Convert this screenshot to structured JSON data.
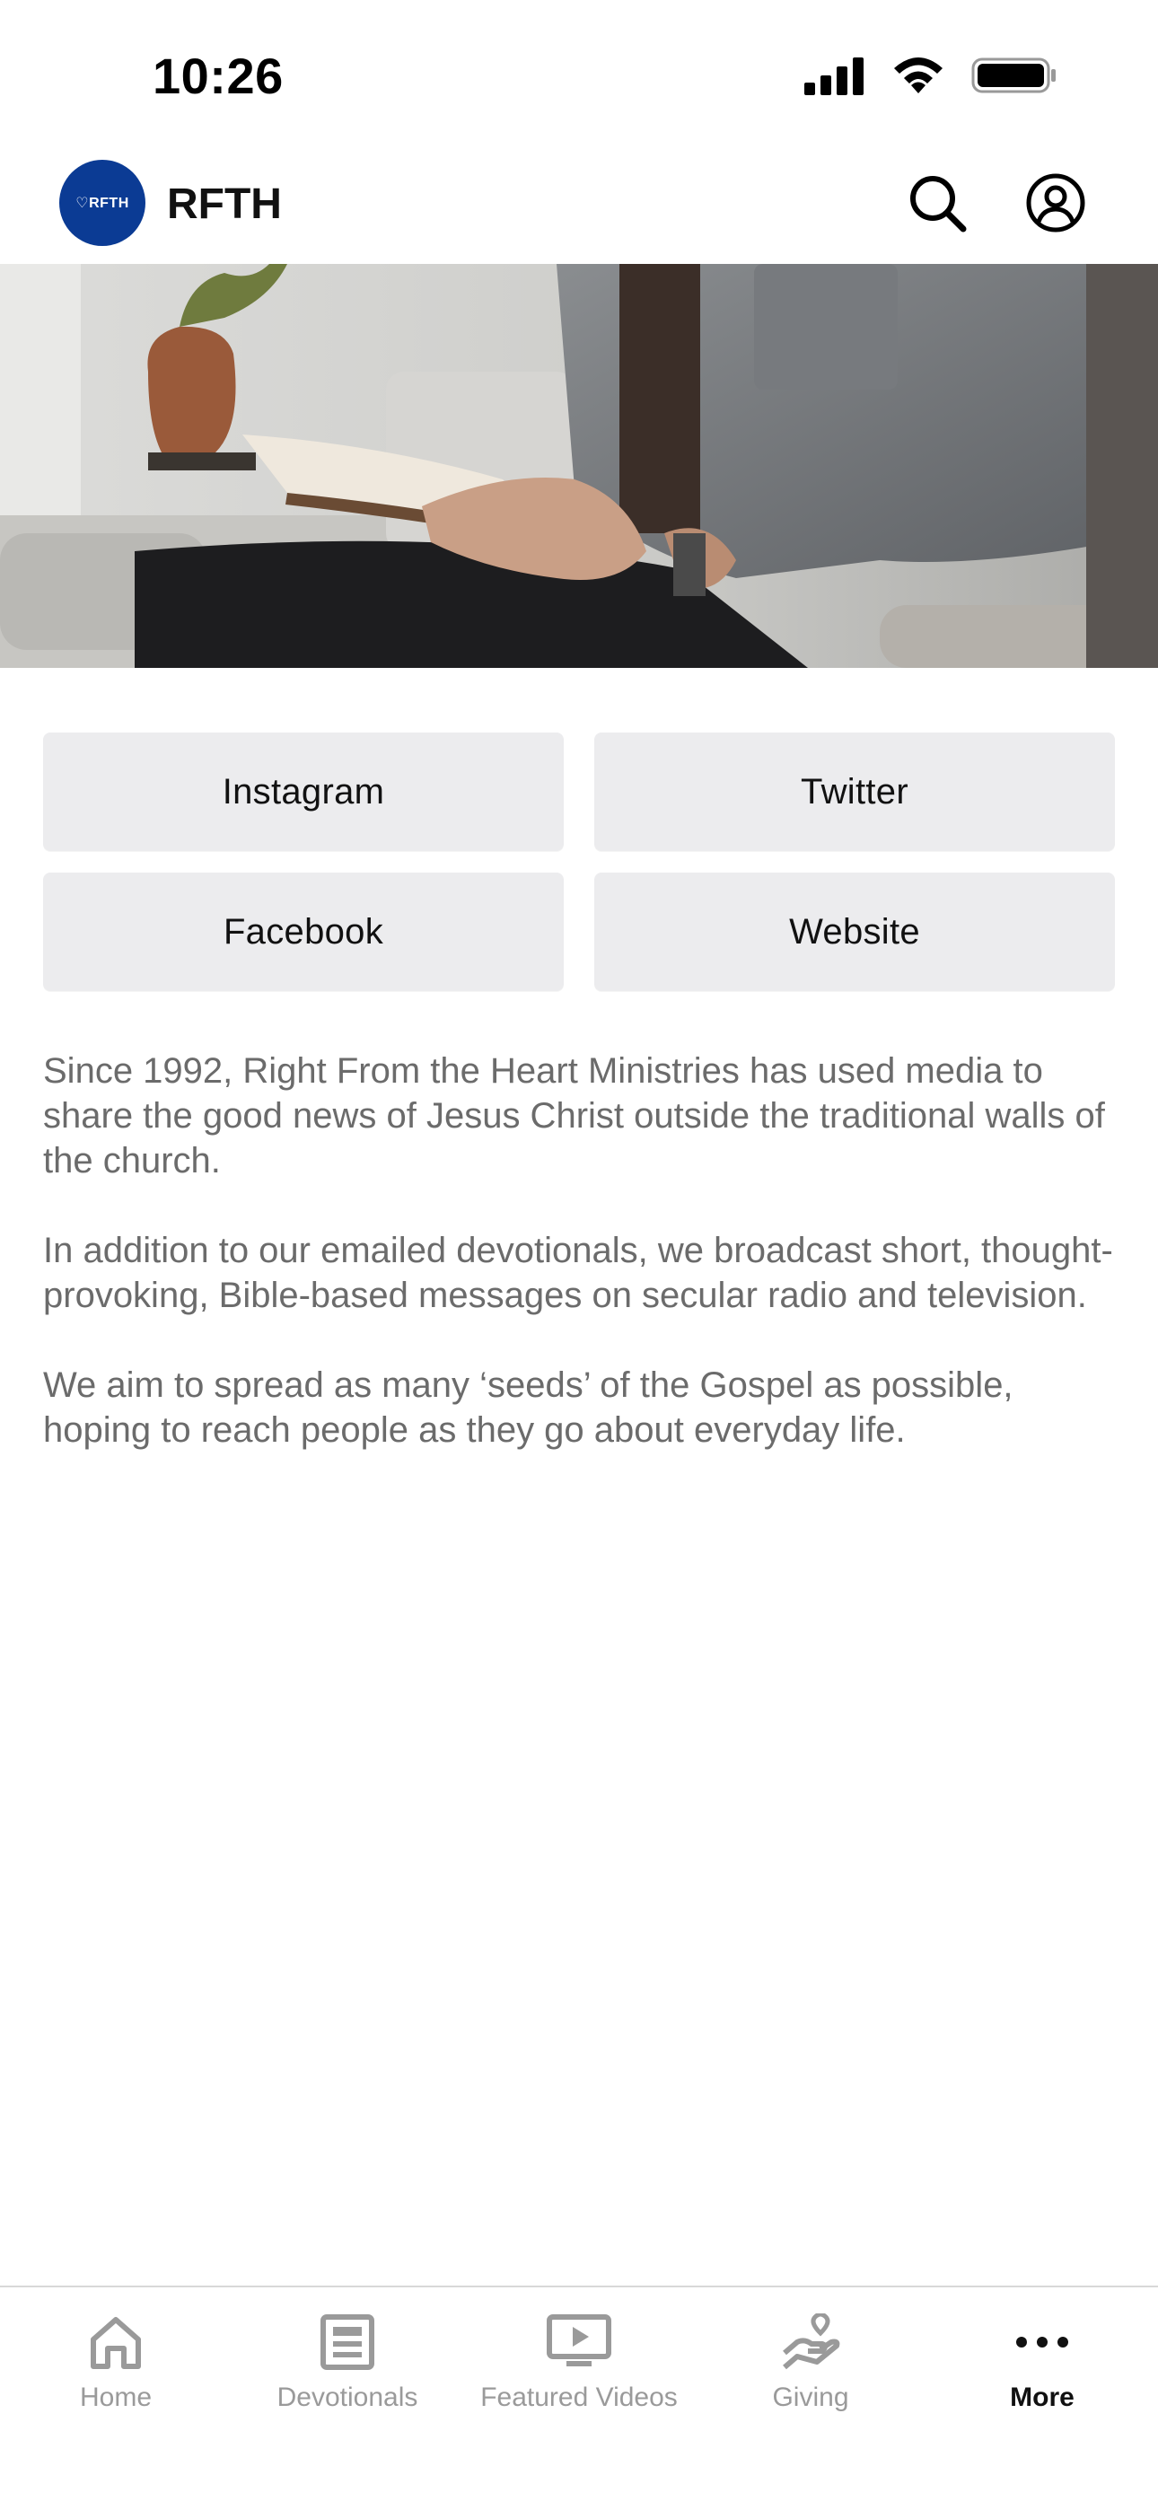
{
  "status_bar": {
    "time": "10:26"
  },
  "header": {
    "logo_text": "♡RFTH",
    "title": "RFTH",
    "search_icon": "search-icon",
    "account_icon": "account-icon"
  },
  "links": [
    {
      "label": "Instagram"
    },
    {
      "label": "Twitter"
    },
    {
      "label": "Facebook"
    },
    {
      "label": "Website"
    }
  ],
  "about": {
    "paragraphs": [
      "Since 1992, Right From the Heart Ministries has used media to share the good news of Jesus Christ outside the traditional walls of the church.",
      "In addition to our emailed devotionals, we broadcast short, thought-provoking, Bible-based messages on secular radio and television.",
      "We aim to spread as many ‘seeds’ of the Gospel as possible, hoping to reach people as they go about everyday life."
    ]
  },
  "tab_bar": {
    "tabs": [
      {
        "label": "Home",
        "icon": "home-icon",
        "active": false
      },
      {
        "label": "Devotionals",
        "icon": "document-icon",
        "active": false
      },
      {
        "label": "Featured Videos",
        "icon": "video-icon",
        "active": false
      },
      {
        "label": "Giving",
        "icon": "giving-icon",
        "active": false
      },
      {
        "label": "More",
        "icon": "more-icon",
        "active": true
      }
    ]
  },
  "colors": {
    "logo_bg": "#0b3b94",
    "button_bg": "#ececee",
    "body_text": "#6b6b6b",
    "tab_inactive": "#9a9a9a",
    "tab_active": "#111111"
  }
}
